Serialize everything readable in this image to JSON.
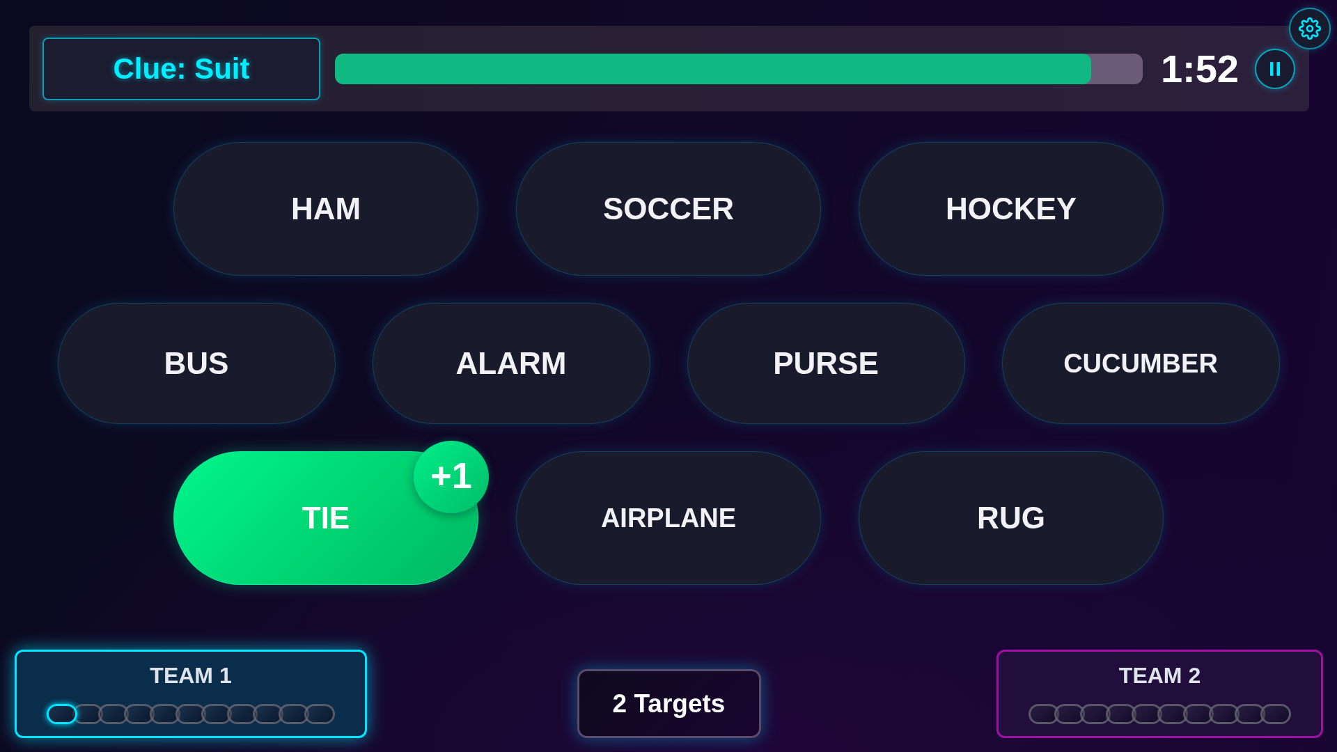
{
  "clue": {
    "label": "Clue: Suit"
  },
  "timer": {
    "level": 0.936,
    "reading": "1:52"
  },
  "board": {
    "rows": [
      {
        "cards": [
          {
            "word": "HAM",
            "found": false
          },
          {
            "word": "SOCCER",
            "found": false
          },
          {
            "word": "HOCKEY",
            "found": false
          }
        ]
      },
      {
        "cards": [
          {
            "word": "BUS",
            "found": false
          },
          {
            "word": "ALARM",
            "found": false
          },
          {
            "word": "PURSE",
            "found": false
          },
          {
            "word": "CUCUMBER",
            "found": false
          }
        ]
      },
      {
        "cards": [
          {
            "word": "TIE",
            "found": true,
            "badge": "+1"
          },
          {
            "word": "AIRPLANE",
            "found": false
          },
          {
            "word": "RUG",
            "found": false
          }
        ]
      }
    ]
  },
  "teams": [
    {
      "name": "TEAM 1",
      "color": "#00e5ff",
      "active": true,
      "pips": [
        {
          "lit": true
        },
        {
          "lit": false
        },
        {
          "lit": false
        },
        {
          "lit": false
        },
        {
          "lit": false
        },
        {
          "lit": false
        },
        {
          "lit": false
        },
        {
          "lit": false
        },
        {
          "lit": false
        },
        {
          "lit": false
        },
        {
          "lit": false
        }
      ]
    },
    {
      "name": "TEAM 2",
      "color": "#9b12a3",
      "active": false,
      "pips": [
        {
          "lit": false
        },
        {
          "lit": false
        },
        {
          "lit": false
        },
        {
          "lit": false
        },
        {
          "lit": false
        },
        {
          "lit": false
        },
        {
          "lit": false
        },
        {
          "lit": false
        },
        {
          "lit": false
        },
        {
          "lit": false
        }
      ]
    }
  ],
  "targets": "2 Targets"
}
